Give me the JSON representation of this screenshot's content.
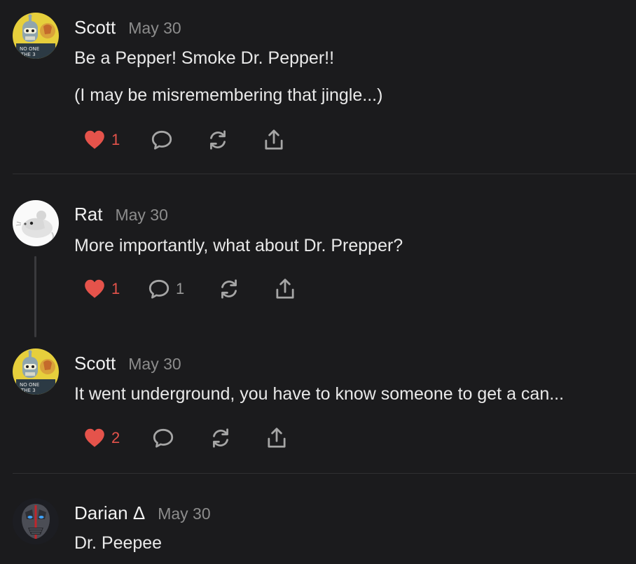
{
  "colors": {
    "background": "#1b1b1d",
    "like": "#e5534b",
    "muted": "#8c8c8c",
    "divider": "#2f2f32"
  },
  "comments": [
    {
      "author": "Scott",
      "date": "May 30",
      "avatar": "bender-avatar",
      "lines": [
        "Be a Pepper! Smoke Dr. Pepper!!",
        "(I may be misremembering that jingle...)"
      ],
      "likes": "1",
      "replies": ""
    },
    {
      "author": "Rat",
      "date": "May 30",
      "avatar": "rat-avatar",
      "lines": [
        "More importantly, what about Dr. Prepper?"
      ],
      "likes": "1",
      "replies": "1"
    },
    {
      "author": "Scott",
      "date": "May 30",
      "avatar": "bender-avatar",
      "lines": [
        "It went underground, you have to know someone to get a can..."
      ],
      "likes": "2",
      "replies": ""
    },
    {
      "author": "Darian Δ",
      "date": "May 30",
      "avatar": "mask-avatar",
      "lines": [
        "Dr. Peepee"
      ],
      "likes": "",
      "replies": ""
    }
  ],
  "icons": {
    "like": "heart-icon",
    "reply": "comment-bubble-icon",
    "restack": "restack-icon",
    "share": "share-icon"
  }
}
